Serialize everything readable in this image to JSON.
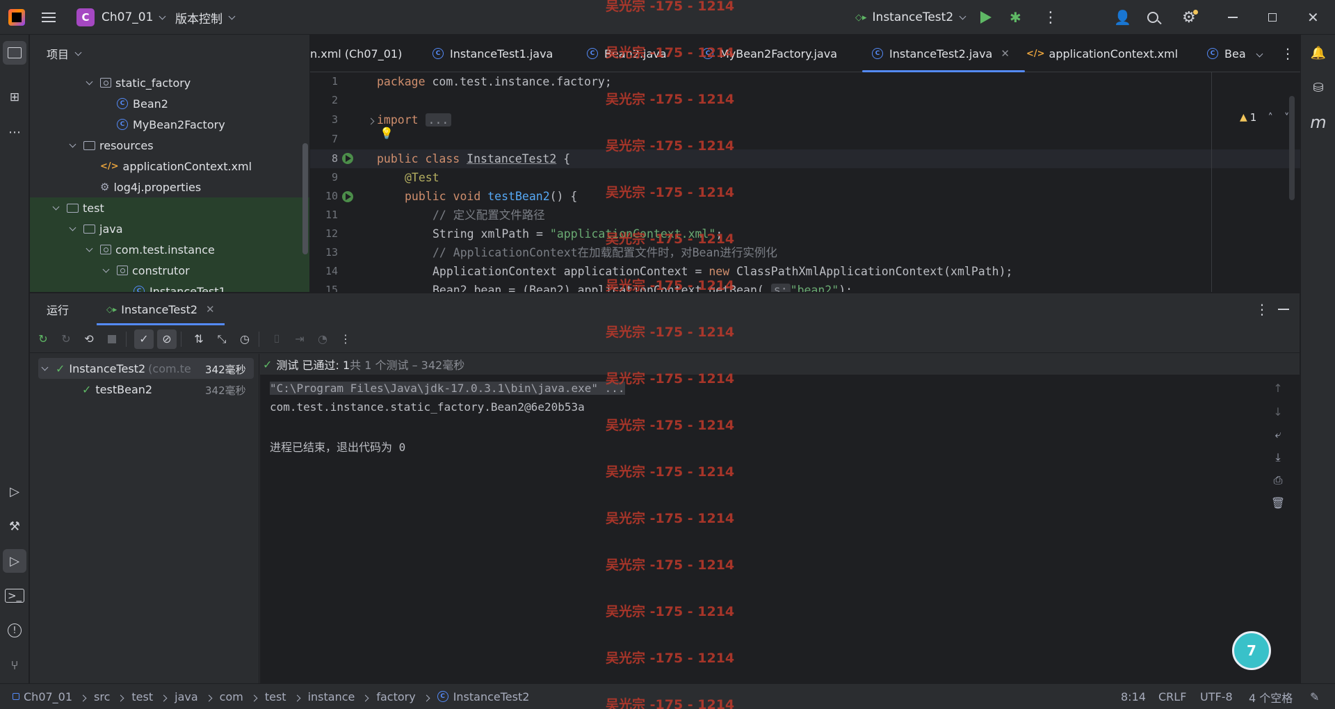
{
  "titlebar": {
    "project_badge": "C",
    "project_name": "Ch07_01",
    "vcs": "版本控制",
    "run_config": "InstanceTest2"
  },
  "project_panel": {
    "header": "项目",
    "rows": [
      {
        "label": "static_factory",
        "type": "package",
        "indent": 3,
        "expanded": true
      },
      {
        "label": "Bean2",
        "type": "class",
        "indent": 4
      },
      {
        "label": "MyBean2Factory",
        "type": "class",
        "indent": 4
      },
      {
        "label": "resources",
        "type": "folder",
        "indent": 2,
        "expanded": true
      },
      {
        "label": "applicationContext.xml",
        "type": "xml",
        "indent": 3
      },
      {
        "label": "log4j.properties",
        "type": "props",
        "indent": 3
      },
      {
        "label": "test",
        "type": "folder",
        "indent": 1,
        "expanded": true
      },
      {
        "label": "java",
        "type": "folder",
        "indent": 2,
        "expanded": true
      },
      {
        "label": "com.test.instance",
        "type": "package",
        "indent": 3,
        "expanded": true
      },
      {
        "label": "construtor",
        "type": "package",
        "indent": 4,
        "expanded": true
      },
      {
        "label": "InstanceTest1",
        "type": "class",
        "indent": 5
      }
    ]
  },
  "editor": {
    "tabs": [
      {
        "label": "n.xml (Ch07_01)",
        "icon": "xml-icon"
      },
      {
        "label": "InstanceTest1.java",
        "icon": "class-icon"
      },
      {
        "label": "Bean2.java",
        "icon": "class-icon"
      },
      {
        "label": "MyBean2Factory.java",
        "icon": "class-icon"
      },
      {
        "label": "InstanceTest2.java",
        "icon": "class-icon",
        "active": true
      },
      {
        "label": "applicationContext.xml",
        "icon": "xml-icon"
      },
      {
        "label": "Bea",
        "icon": "class-icon"
      }
    ],
    "line_numbers": [
      "1",
      "2",
      "3",
      "7",
      "8",
      "9",
      "10",
      "11",
      "12",
      "13",
      "14",
      "15"
    ],
    "warning_count": "1",
    "code": {
      "l1_kw": "package",
      "l1_rest": " com.test.instance.factory;",
      "l3_kw": "import",
      "l3_fold": "...",
      "l8_kw": "public class",
      "l8_cls": "InstanceTest2",
      "l8_rest": " {",
      "l9_ann": "@Test",
      "l10_kw": "public void",
      "l10_fn": "testBean2",
      "l10_rest": "() {",
      "l11_cm": "// 定义配置文件路径",
      "l12_a": "String xmlPath = ",
      "l12_str": "\"applicationContext.xml\"",
      "l12_b": ";",
      "l13_cm": "// ApplicationContext在加载配置文件时，对Bean进行实例化",
      "l14_a": "ApplicationContext applicationContext = ",
      "l14_kw": "new",
      "l14_b": " ClassPathXmlApplicationContext(xmlPath);",
      "l15_a": "Bean2 bean = (Bean2) applicationContext.getBean( ",
      "l15_hint": "s:",
      "l15_str": "\"bean2\"",
      "l15_b": ");"
    }
  },
  "run_panel": {
    "title": "运行",
    "tab": "InstanceTest2",
    "tree": {
      "root_label": "InstanceTest2",
      "root_pkg": "(com.te",
      "root_time": "342毫秒",
      "child_label": "testBean2",
      "child_time": "342毫秒"
    },
    "status_passed": "测试 已通过: 1",
    "status_detail": "共 1 个测试 – 342毫秒",
    "console": [
      "\"C:\\Program Files\\Java\\jdk-17.0.3.1\\bin\\java.exe\" ...",
      "com.test.instance.static_factory.Bean2@6e20b53a",
      "",
      "进程已结束，退出代码为 0"
    ]
  },
  "statusbar": {
    "breadcrumbs": [
      "Ch07_01",
      "src",
      "test",
      "java",
      "com",
      "test",
      "instance",
      "factory",
      "InstanceTest2"
    ],
    "position": "8:14",
    "line_sep": "CRLF",
    "encoding": "UTF-8",
    "indent": "4 个空格"
  },
  "watermark": "吴光宗 -175 - 1214",
  "colors": {
    "accent": "#548af7",
    "pass": "#5fb865",
    "watermark": "#c0392b"
  }
}
